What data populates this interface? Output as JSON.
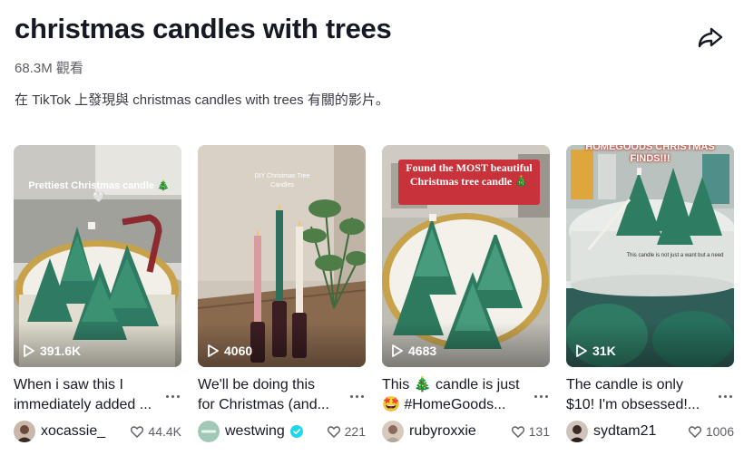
{
  "header": {
    "title": "christmas candles with trees",
    "views": "68.3M 觀看",
    "description": "在 TikTok 上發現與 christmas candles with trees 有關的影片。"
  },
  "videos": [
    {
      "overlay": "Prettiest Christmas candle 🎄🤍",
      "play_count": "391.6K",
      "caption_line1": "When i saw this I",
      "caption_line2": "immediately added ...",
      "author": "xocassie_",
      "likes": "44.4K",
      "verified": false
    },
    {
      "overlay": "DIY Christmas Tree Candles",
      "play_count": "4060",
      "caption_line1": "We'll be doing this",
      "caption_line2": "for Christmas (and...",
      "author": "westwing",
      "likes": "221",
      "verified": true
    },
    {
      "overlay": "Found the MOST beautiful Christmas tree candle 🎄",
      "play_count": "4683",
      "caption_line1": "This 🎄 candle is just",
      "caption_line2": "🤩 #HomeGoods...",
      "author": "rubyroxxie",
      "likes": "131",
      "verified": false
    },
    {
      "overlay": "HOMEGOODS CHRISTMAS FINDS!!!",
      "overlay_small": "This candle is not just a want but a need",
      "play_count": "31K",
      "caption_line1": "The candle is only",
      "caption_line2": "$10! I'm obsessed!...",
      "author": "sydtam21",
      "likes": "1006",
      "verified": false
    }
  ]
}
